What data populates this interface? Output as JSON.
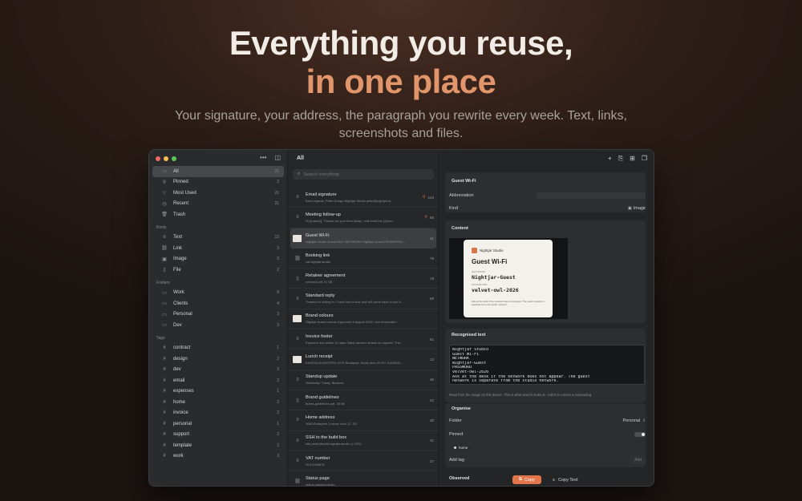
{
  "hero": {
    "line1": "Everything you reuse,",
    "line2": "in one place",
    "subtitle": "Your signature, your address, the paragraph you rewrite every week. Text, links, screenshots and files."
  },
  "sidebar": {
    "primary": [
      {
        "label": "All",
        "count": "21",
        "icon": "tray-icon",
        "glyph": "▭",
        "active": true
      },
      {
        "label": "Pinned",
        "count": "2",
        "icon": "pin-icon",
        "glyph": "⚲"
      },
      {
        "label": "Most Used",
        "count": "21",
        "icon": "star-icon",
        "glyph": "☆"
      },
      {
        "label": "Recent",
        "count": "21",
        "icon": "clock-icon",
        "glyph": "◷"
      },
      {
        "label": "Trash",
        "count": "",
        "icon": "trash-icon",
        "glyph": "🗑"
      }
    ],
    "kinds_title": "Kinds",
    "kinds": [
      {
        "label": "Text",
        "count": "13",
        "icon": "text-icon",
        "glyph": "≡"
      },
      {
        "label": "Link",
        "count": "3",
        "icon": "link-icon",
        "glyph": "⛓"
      },
      {
        "label": "Image",
        "count": "3",
        "icon": "image-icon",
        "glyph": "▣"
      },
      {
        "label": "File",
        "count": "2",
        "icon": "file-icon",
        "glyph": "▯"
      }
    ],
    "folders_title": "Folders",
    "folders": [
      {
        "label": "Work",
        "count": "8",
        "icon": "folder-icon",
        "glyph": "▭"
      },
      {
        "label": "Clients",
        "count": "4",
        "icon": "folder-icon",
        "glyph": "▭"
      },
      {
        "label": "Personal",
        "count": "3",
        "icon": "folder-icon",
        "glyph": "▭"
      },
      {
        "label": "Dev",
        "count": "3",
        "icon": "folder-icon",
        "glyph": "▭"
      }
    ],
    "tags_title": "Tags",
    "tags": [
      {
        "label": "contract",
        "count": "1"
      },
      {
        "label": "design",
        "count": "2"
      },
      {
        "label": "dev",
        "count": "3"
      },
      {
        "label": "email",
        "count": "2"
      },
      {
        "label": "expenses",
        "count": "1"
      },
      {
        "label": "home",
        "count": "2"
      },
      {
        "label": "invoice",
        "count": "2"
      },
      {
        "label": "personal",
        "count": "1"
      },
      {
        "label": "support",
        "count": "2"
      },
      {
        "label": "template",
        "count": "2"
      },
      {
        "label": "work",
        "count": "3"
      }
    ]
  },
  "list": {
    "title": "All",
    "search_placeholder": "Search everything",
    "rows": [
      {
        "title": "Email signature",
        "sub": "Best regards, Peter Dongo Nightjar Studio peter@nightjar.st...",
        "count": "143",
        "pinned": true,
        "icon": "text-icon",
        "glyph": "≡"
      },
      {
        "title": "Meeting follow-up",
        "sub": "Hi {{name}}, Thanks for your time today. I will send the {{docu...",
        "count": "86",
        "pinned": true,
        "icon": "text-icon",
        "glyph": "≡"
      },
      {
        "title": "Guest Wi-Fi",
        "sub": "Nightjar Studio Guest Wi-Fi NETWORK Nightjar-Guest PASSWORD...",
        "count": "41",
        "pinned": false,
        "thumb": true,
        "active": true
      },
      {
        "title": "Booking link",
        "sub": "cal.nightjar.studio",
        "count": "78",
        "pinned": false,
        "icon": "link-icon",
        "glyph": "⛓"
      },
      {
        "title": "Retainer agreement",
        "sub": "contract.pdf, 57 kB",
        "count": "19",
        "pinned": false,
        "icon": "file-icon",
        "glyph": "▯"
      },
      {
        "title": "Standard reply",
        "sub": "Thanks for writing in. I have had a look and will come back to you b...",
        "count": "89",
        "pinned": false,
        "icon": "text-icon",
        "glyph": "≡"
      },
      {
        "title": "Brand colours",
        "sub": "Nightjar brand colours Approved 4 August 2026. Use terracotta f...",
        "count": "",
        "pinned": false,
        "thumb": true
      },
      {
        "title": "Invoice footer",
        "sub": "Payment due within 14 days. Bank transfer details on request. Tha...",
        "count": "61",
        "pinned": false,
        "icon": "text-icon",
        "glyph": "≡"
      },
      {
        "title": "Lunch receipt",
        "sub": "KASSZA KOASTERS 1075 Budapest, Király utca 40 HU 11428431...",
        "count": "12",
        "pinned": false,
        "thumb": true
      },
      {
        "title": "Standup update",
        "sub": "Yesterday: Today: Blocked:",
        "count": "45",
        "pinned": false,
        "icon": "text-icon",
        "glyph": "≡"
      },
      {
        "title": "Brand guidelines",
        "sub": "brand-guidelines.pdf, 30 kB",
        "count": "22",
        "pinned": false,
        "icon": "file-icon",
        "glyph": "▯"
      },
      {
        "title": "Home address",
        "sub": "1083 Budapest, Losonc utca 12. 3/2",
        "count": "30",
        "pinned": false,
        "icon": "text-icon",
        "glyph": "≡"
      },
      {
        "title": "SSH to the build box",
        "sub": "ssh peter@build.nightjar.studio -p 2222",
        "count": "31",
        "pinned": false,
        "icon": "text-icon",
        "glyph": "≡"
      },
      {
        "title": "VAT number",
        "sub": "HU12345678",
        "count": "27",
        "pinned": false,
        "icon": "text-icon",
        "glyph": "≡"
      },
      {
        "title": "Status page",
        "sub": "status.nightjar.studio",
        "count": "",
        "pinned": false,
        "icon": "link-icon",
        "glyph": "⛓"
      }
    ]
  },
  "detail": {
    "title": "Guest Wi-Fi",
    "abbreviation_label": "Abbreviation",
    "kind_label": "Kind",
    "kind_value": "Image",
    "content_label": "Content",
    "wifi_card": {
      "brand": "Nightjar Studio",
      "title": "Guest Wi-Fi",
      "network_label": "NETWORK",
      "network": "Nightjar-Guest",
      "password_label": "PASSWORD",
      "password": "velvet-owl-2026",
      "note": "Ask at the desk if the network does not appear. The guest network is separate from the studio network."
    },
    "recognised_label": "Recognised text",
    "recognised_lines": [
      "Nightjar Studio",
      "Guest Wi-Fi",
      "NETWORK",
      "Nightjar-Guest",
      "PASSWORD",
      "velvet-owl-2026",
      "Ask at the desk if the network does not appear. The guest",
      "network is separate from the studio network."
    ],
    "help_text": "Read from the image on this device. This is what search looks at - edit it to correct a misreading.",
    "organise_label": "Organise",
    "folder_label": "Folder",
    "folder_value": "Personal",
    "pinned_label": "Pinned",
    "tag_chip": "home",
    "add_tag_label": "Add tag",
    "add_button": "Add",
    "observed_label": "Observed",
    "copy_button": "Copy",
    "copy_text_button": "Copy Text"
  }
}
